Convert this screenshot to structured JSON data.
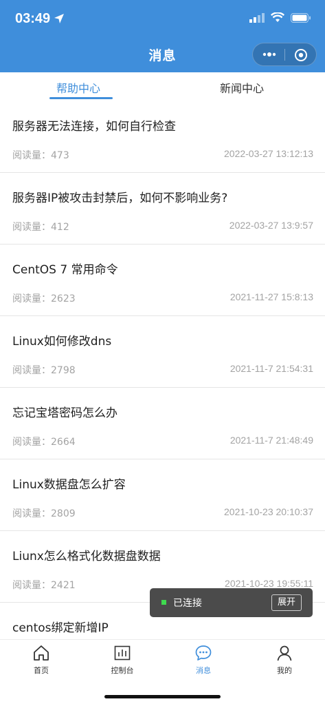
{
  "status_bar": {
    "time": "03:49"
  },
  "nav": {
    "title": "消息"
  },
  "tabs": [
    {
      "label": "帮助中心",
      "active": true
    },
    {
      "label": "新闻中心",
      "active": false
    }
  ],
  "articles": [
    {
      "title": "服务器无法连接，如何自行检查",
      "reads_label": "阅读量：473",
      "date": "2022-03-27 13:12:13"
    },
    {
      "title": "服务器IP被攻击封禁后，如何不影响业务?",
      "reads_label": "阅读量：412",
      "date": "2022-03-27 13:9:57"
    },
    {
      "title": "CentOS 7 常用命令",
      "reads_label": "阅读量：2623",
      "date": "2021-11-27 15:8:13"
    },
    {
      "title": "Linux如何修改dns",
      "reads_label": "阅读量：2798",
      "date": "2021-11-7 21:54:31"
    },
    {
      "title": "忘记宝塔密码怎么办",
      "reads_label": "阅读量：2664",
      "date": "2021-11-7 21:48:49"
    },
    {
      "title": "Linux数据盘怎么扩容",
      "reads_label": "阅读量：2809",
      "date": "2021-10-23 20:10:37"
    },
    {
      "title": "Liunx怎么格式化数据盘数据",
      "reads_label": "阅读量：2421",
      "date": "2021-10-23 19:55:11"
    },
    {
      "title": "centos绑定新增IP",
      "reads_label": "",
      "date": ""
    }
  ],
  "toast": {
    "text": "已连接",
    "button": "展开"
  },
  "tabbar": [
    {
      "label": "首页",
      "icon": "home-icon"
    },
    {
      "label": "控制台",
      "icon": "chart-icon"
    },
    {
      "label": "消息",
      "icon": "message-icon",
      "active": true
    },
    {
      "label": "我的",
      "icon": "user-icon"
    }
  ],
  "colors": {
    "brand": "#3f8edb",
    "text": "#1f1f1f",
    "muted": "#a3a3a3"
  }
}
